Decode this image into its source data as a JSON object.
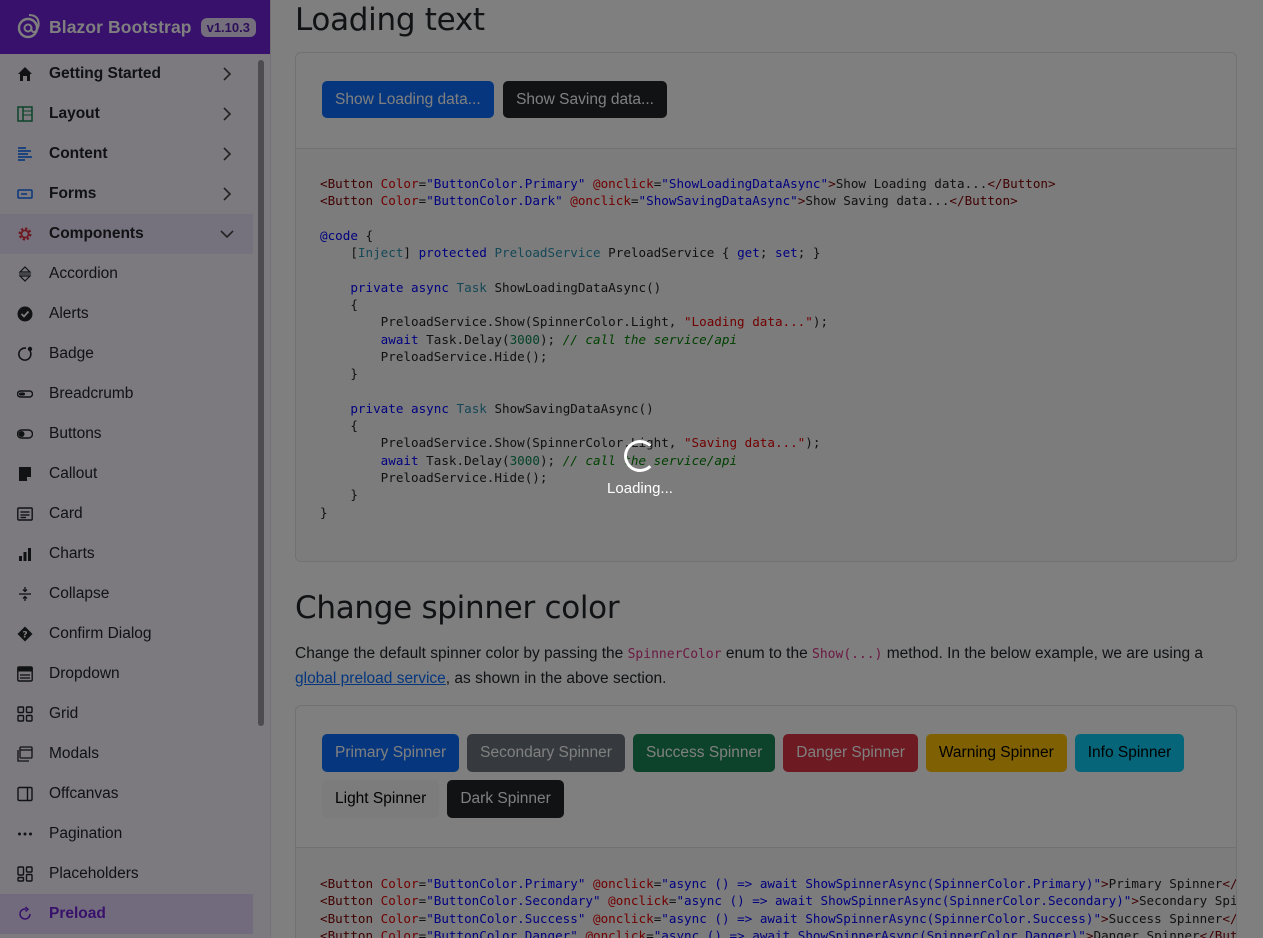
{
  "brand": {
    "title": "Blazor Bootstrap",
    "version": "v1.10.3"
  },
  "nav": [
    {
      "label": "Getting Started",
      "icon": "home-icon",
      "group": true
    },
    {
      "label": "Layout",
      "icon": "layout-icon",
      "group": true
    },
    {
      "label": "Content",
      "icon": "content-icon",
      "group": true
    },
    {
      "label": "Forms",
      "icon": "forms-icon",
      "group": true
    },
    {
      "label": "Components",
      "icon": "gear-icon",
      "group": true,
      "expanded": true
    },
    {
      "label": "Accordion",
      "icon": "accordion-icon"
    },
    {
      "label": "Alerts",
      "icon": "check-circle-icon"
    },
    {
      "label": "Badge",
      "icon": "badge-icon"
    },
    {
      "label": "Breadcrumb",
      "icon": "breadcrumb-icon"
    },
    {
      "label": "Buttons",
      "icon": "toggle-icon"
    },
    {
      "label": "Callout",
      "icon": "callout-icon"
    },
    {
      "label": "Card",
      "icon": "card-icon"
    },
    {
      "label": "Charts",
      "icon": "bar-chart-icon"
    },
    {
      "label": "Collapse",
      "icon": "collapse-icon"
    },
    {
      "label": "Confirm Dialog",
      "icon": "question-diamond-icon"
    },
    {
      "label": "Dropdown",
      "icon": "dropdown-icon"
    },
    {
      "label": "Grid",
      "icon": "grid-icon"
    },
    {
      "label": "Modals",
      "icon": "modal-icon"
    },
    {
      "label": "Offcanvas",
      "icon": "offcanvas-icon"
    },
    {
      "label": "Pagination",
      "icon": "dots-icon"
    },
    {
      "label": "Placeholders",
      "icon": "placeholder-icon"
    },
    {
      "label": "Preload",
      "icon": "refresh-icon",
      "active": true
    }
  ],
  "main": {
    "section1": {
      "title": "Loading text",
      "buttons": [
        "Show Loading data...",
        "Show Saving data..."
      ]
    },
    "section2": {
      "title": "Change spinner color",
      "para_1": "Change the default spinner color by passing the ",
      "para_code1": "SpinnerColor",
      "para_2": " enum to the ",
      "para_code2": "Show(...)",
      "para_3": " method. In the below example, we are using a ",
      "para_link": "global preload service",
      "para_4": ", as shown in the above section.",
      "buttons": [
        "Primary Spinner",
        "Secondary Spinner",
        "Success Spinner",
        "Danger Spinner",
        "Warning Spinner",
        "Info Spinner",
        "Light Spinner",
        "Dark Spinner"
      ]
    }
  },
  "overlay": {
    "loading_text": "Loading..."
  },
  "colors": {
    "brand": "#6f22d6",
    "primary": "#0d6efd",
    "secondary": "#6c757d",
    "success": "#198754",
    "danger": "#dc3545",
    "warning": "#ffc107",
    "info": "#0dcaf0",
    "light": "#f8f9fa",
    "dark": "#212529"
  }
}
